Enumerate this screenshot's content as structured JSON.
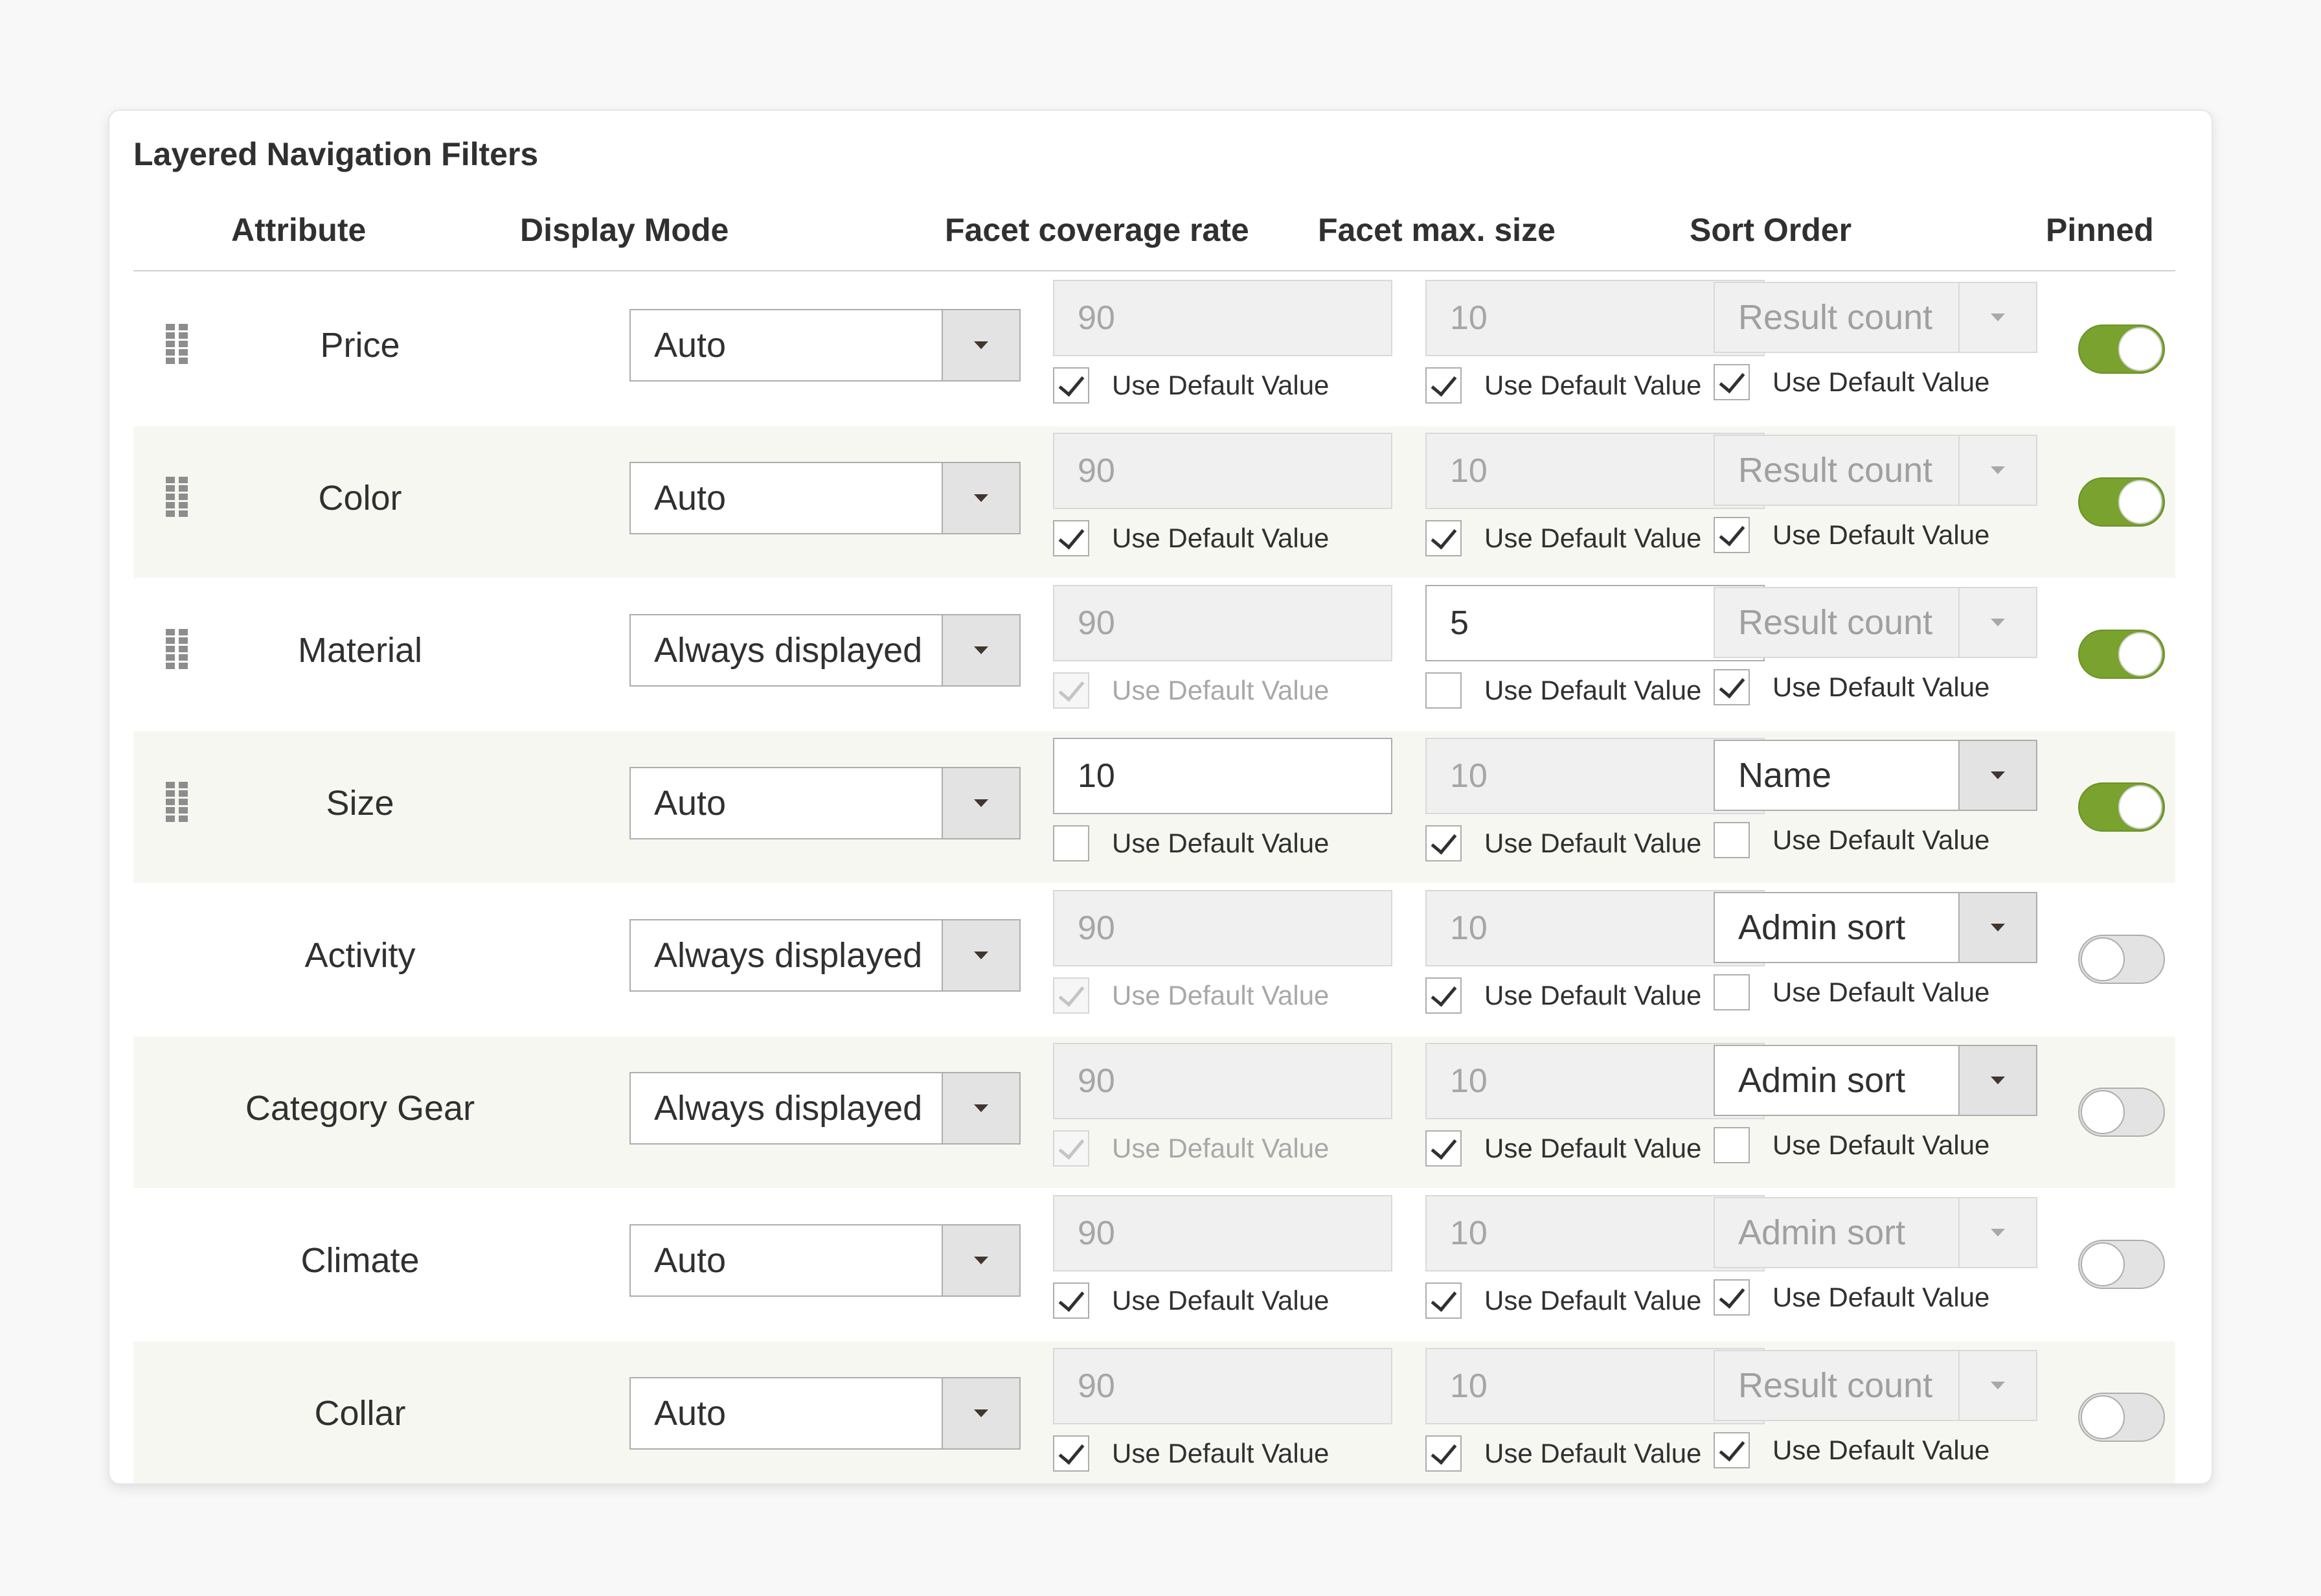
{
  "panel": {
    "title": "Layered Navigation Filters"
  },
  "columns": {
    "attribute": "Attribute",
    "display_mode": "Display Mode",
    "coverage": "Facet coverage rate",
    "max_size": "Facet max. size",
    "sort_order": "Sort Order",
    "pinned": "Pinned"
  },
  "use_default_label": "Use Default Value",
  "icons": {
    "drag_handle": "drag-handle-icon",
    "dropdown_arrow": "dropdown-arrow-icon",
    "checkbox_check": "check-icon"
  },
  "colors": {
    "toggle_on": "#79a22e",
    "alt_row": "#f7f7f2"
  },
  "rows": [
    {
      "attribute": "Price",
      "draggable": true,
      "display_mode": "Auto",
      "coverage": "90",
      "coverage_default": true,
      "coverage_disabled": true,
      "coverage_cb_disabled": false,
      "max_size": "10",
      "max_default": true,
      "max_disabled": true,
      "sort": "Result count",
      "sort_default": true,
      "sort_disabled": true,
      "pinned": true
    },
    {
      "attribute": "Color",
      "draggable": true,
      "display_mode": "Auto",
      "coverage": "90",
      "coverage_default": true,
      "coverage_disabled": true,
      "coverage_cb_disabled": false,
      "max_size": "10",
      "max_default": true,
      "max_disabled": true,
      "sort": "Result count",
      "sort_default": true,
      "sort_disabled": true,
      "pinned": true
    },
    {
      "attribute": "Material",
      "draggable": true,
      "display_mode": "Always displayed",
      "coverage": "90",
      "coverage_default": true,
      "coverage_disabled": true,
      "coverage_cb_disabled": true,
      "max_size": "5",
      "max_default": false,
      "max_disabled": false,
      "sort": "Result count",
      "sort_default": true,
      "sort_disabled": true,
      "pinned": true
    },
    {
      "attribute": "Size",
      "draggable": true,
      "display_mode": "Auto",
      "coverage": "10",
      "coverage_default": false,
      "coverage_disabled": false,
      "coverage_cb_disabled": false,
      "max_size": "10",
      "max_default": true,
      "max_disabled": true,
      "sort": "Name",
      "sort_default": false,
      "sort_disabled": false,
      "pinned": true
    },
    {
      "attribute": "Activity",
      "draggable": false,
      "display_mode": "Always displayed",
      "coverage": "90",
      "coverage_default": true,
      "coverage_disabled": true,
      "coverage_cb_disabled": true,
      "max_size": "10",
      "max_default": true,
      "max_disabled": true,
      "sort": "Admin sort",
      "sort_default": false,
      "sort_disabled": false,
      "pinned": false
    },
    {
      "attribute": "Category Gear",
      "draggable": false,
      "display_mode": "Always displayed",
      "coverage": "90",
      "coverage_default": true,
      "coverage_disabled": true,
      "coverage_cb_disabled": true,
      "max_size": "10",
      "max_default": true,
      "max_disabled": true,
      "sort": "Admin sort",
      "sort_default": false,
      "sort_disabled": false,
      "pinned": false
    },
    {
      "attribute": "Climate",
      "draggable": false,
      "display_mode": "Auto",
      "coverage": "90",
      "coverage_default": true,
      "coverage_disabled": true,
      "coverage_cb_disabled": false,
      "max_size": "10",
      "max_default": true,
      "max_disabled": true,
      "sort": "Admin sort",
      "sort_default": true,
      "sort_disabled": true,
      "pinned": false
    },
    {
      "attribute": "Collar",
      "draggable": false,
      "display_mode": "Auto",
      "coverage": "90",
      "coverage_default": true,
      "coverage_disabled": true,
      "coverage_cb_disabled": false,
      "max_size": "10",
      "max_default": true,
      "max_disabled": true,
      "sort": "Result count",
      "sort_default": true,
      "sort_disabled": true,
      "pinned": false
    }
  ]
}
